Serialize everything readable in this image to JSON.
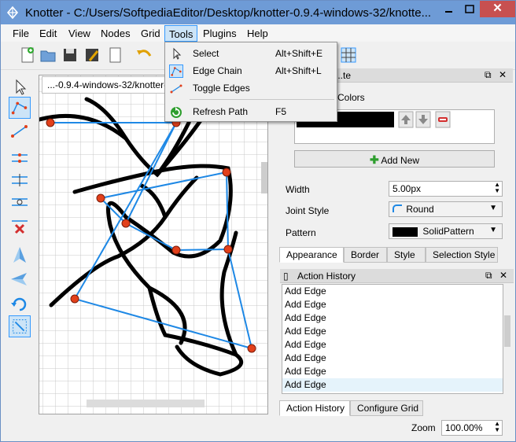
{
  "window": {
    "title": "Knotter - C:/Users/SoftpediaEditor/Desktop/knotter-0.9.4-windows-32/knotte...",
    "close_glyph": "✕",
    "min_glyph": "▁",
    "max_glyph": "▢"
  },
  "menubar": {
    "items": [
      "File",
      "Edit",
      "View",
      "Nodes",
      "Grid",
      "Tools",
      "Plugins",
      "Help"
    ]
  },
  "tools_menu": {
    "items": [
      {
        "label": "Select",
        "shortcut": "Alt+Shift+E",
        "icon": "pointer-icon"
      },
      {
        "label": "Edge Chain",
        "shortcut": "Alt+Shift+L",
        "icon": "edge-chain-icon"
      },
      {
        "label": "Toggle Edges",
        "shortcut": "",
        "icon": "toggle-edges-icon"
      },
      {
        "label": "Refresh Path",
        "shortcut": "F5",
        "icon": "refresh-icon"
      }
    ]
  },
  "document": {
    "tab_label": "...-0.9.4-windows-32/knotter-0..."
  },
  "style_panel": {
    "title": "...te",
    "colors_label": "Colors",
    "add_new_label": "Add New",
    "width_label": "Width",
    "width_value": "5.00px",
    "joint_label": "Joint Style",
    "joint_value": "Round",
    "pattern_label": "Pattern",
    "pattern_value": "SolidPattern",
    "tabs": [
      "Appearance",
      "Border",
      "Style",
      "Selection Style"
    ]
  },
  "history_panel": {
    "title": "Action History",
    "items": [
      "Add Edge",
      "Add Edge",
      "Add Edge",
      "Add Edge",
      "Add Edge",
      "Add Edge",
      "Add Edge",
      "Add Edge"
    ],
    "tabs": [
      "Action History",
      "Configure Grid"
    ]
  },
  "status": {
    "zoom_label": "Zoom",
    "zoom_value": "100.00%"
  },
  "colors": {
    "accent": "#3399ff",
    "knot": "#000000",
    "edge": "#1e88e5",
    "node": "#e2401b"
  }
}
